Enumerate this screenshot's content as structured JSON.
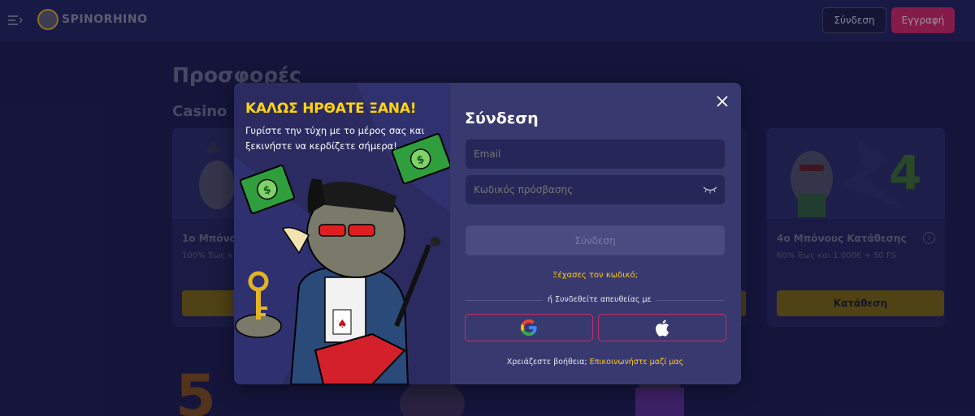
{
  "header": {
    "logo_text": "SPINORHINO",
    "login_label": "Σύνδεση",
    "register_label": "Εγγραφή"
  },
  "page": {
    "title": "Προσφορές",
    "section": "Casino",
    "cards": [
      {
        "title": "1ο Μπόνους",
        "subtitle": "100% Έως κ"
      },
      {
        "title": "4ο Μπόνους Κατάθεσης",
        "subtitle": "60% Έως και 1.000€ + 50 FS",
        "button_label": "Κατάθεση"
      }
    ]
  },
  "modal": {
    "promo_headline": "ΚΑΛΩΣ ΗΡΘΑΤΕ ΞΑΝΑ!",
    "promo_subtitle": "Γυρίστε την τύχη με το μέρος σας και ξεκινήστε να κερδίζετε σήμερα!",
    "form_title": "Σύνδεση",
    "email_placeholder": "Email",
    "password_placeholder": "Κωδικός πρόσβασης",
    "submit_label": "Σύνδεση",
    "forgot_password": "Ξέχασες τον κωδικό;",
    "or_connect": "ή Συνδεθείτε απευθείας με",
    "help_text": "Χρειάζεστε βοήθεια;",
    "help_link": "Επικοινωνήστε μαζί μας"
  },
  "colors": {
    "accent_yellow": "#ffd40f",
    "brand_pink": "#c6265c",
    "modal_bg": "#38396e",
    "page_bg": "#1d1d4a"
  }
}
